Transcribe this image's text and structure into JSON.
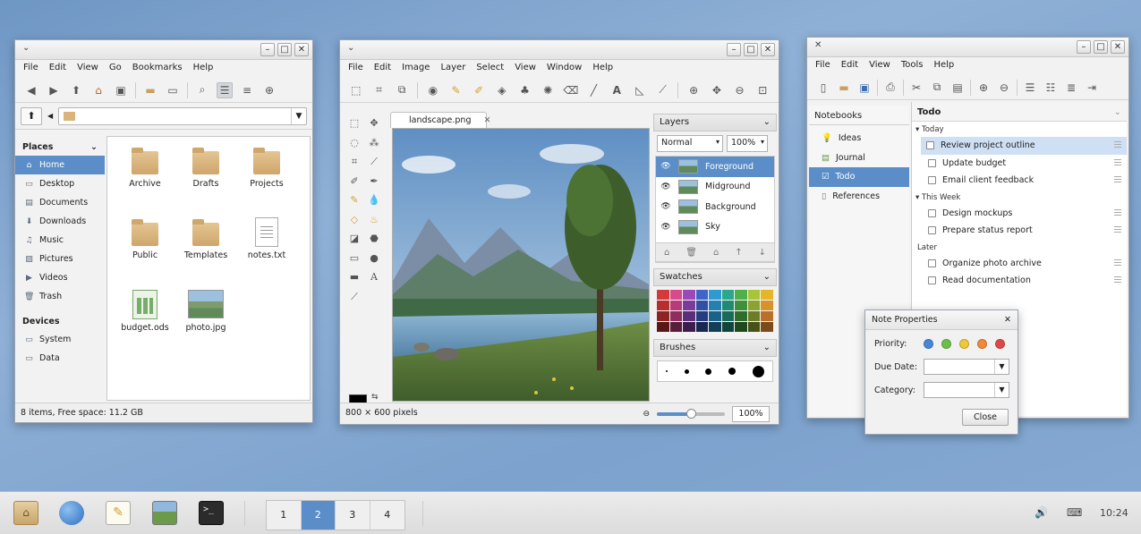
{
  "file_manager": {
    "menu": [
      "File",
      "Edit",
      "View",
      "Go",
      "Bookmarks",
      "Help"
    ],
    "places_header": "Places",
    "places": [
      {
        "label": "Home",
        "icon": "home-icon",
        "selected": true
      },
      {
        "label": "Desktop",
        "icon": "desktop-icon"
      },
      {
        "label": "Documents",
        "icon": "documents-icon"
      },
      {
        "label": "Downloads",
        "icon": "downloads-icon"
      },
      {
        "label": "Music",
        "icon": "music-icon"
      },
      {
        "label": "Pictures",
        "icon": "pictures-icon"
      },
      {
        "label": "Videos",
        "icon": "videos-icon"
      },
      {
        "label": "Trash",
        "icon": "trash-icon"
      }
    ],
    "devices_header": "Devices",
    "devices": [
      {
        "label": "System",
        "icon": "drive-icon"
      },
      {
        "label": "Data",
        "icon": "drive-icon"
      }
    ],
    "items": [
      {
        "label": "Archive",
        "type": "folder"
      },
      {
        "label": "Drafts",
        "type": "folder"
      },
      {
        "label": "Projects",
        "type": "folder"
      },
      {
        "label": "Public",
        "type": "folder"
      },
      {
        "label": "Templates",
        "type": "folder"
      },
      {
        "label": "notes.txt",
        "type": "text"
      },
      {
        "label": "budget.ods",
        "type": "spreadsheet"
      },
      {
        "label": "photo.jpg",
        "type": "image"
      }
    ],
    "status": "8 items, Free space: 11.2 GB"
  },
  "image_editor": {
    "menu": [
      "File",
      "Edit",
      "Image",
      "Layer",
      "Select",
      "View",
      "Window",
      "Help"
    ],
    "tab_label": "landscape.png",
    "layers_header": "Layers",
    "blend_mode": "Normal",
    "opacity": "100%",
    "layers": [
      {
        "label": "Foreground",
        "selected": true
      },
      {
        "label": "Midground"
      },
      {
        "label": "Background"
      },
      {
        "label": "Sky"
      }
    ],
    "swatches_header": "Swatches",
    "swatch_colors": [
      "#d23b3b",
      "#d84a8c",
      "#9b49b8",
      "#3e66c8",
      "#2f9ad2",
      "#2aa88e",
      "#4fb04a",
      "#a8c53a",
      "#e6b62a",
      "#b82d2d",
      "#b73a7a",
      "#7c3a9a",
      "#314fa6",
      "#2480b0",
      "#208a74",
      "#3f8f3b",
      "#8ba330",
      "#d8922a",
      "#8e2323",
      "#8e2d5e",
      "#5e2d78",
      "#253c80",
      "#1b6289",
      "#186a59",
      "#2f6d2d",
      "#6b7e25",
      "#b8702a",
      "#5a1717",
      "#5a1d3c",
      "#3c1d4d",
      "#182752",
      "#123f58",
      "#10453a",
      "#1f481e",
      "#465218",
      "#7d4a1c"
    ],
    "brushes_header": "Brushes",
    "status": "800 × 600 pixels",
    "zoom": "100%",
    "zoom_fraction": 0.5
  },
  "notes": {
    "menu": [
      "File",
      "Edit",
      "View",
      "Tools",
      "Help"
    ],
    "notebooks_header": "Notebooks",
    "notebooks": [
      {
        "label": "Ideas",
        "icon": "lightbulb-icon"
      },
      {
        "label": "Journal",
        "icon": "journal-icon"
      },
      {
        "label": "Todo",
        "icon": "checkbox-icon",
        "selected": true
      },
      {
        "label": "References",
        "icon": "document-icon"
      }
    ],
    "list_title": "Todo",
    "groups": [
      {
        "label": "Today",
        "tasks": [
          "Review project outline",
          "Update budget",
          "Email client feedback"
        ]
      },
      {
        "label": "This Week",
        "tasks": [
          "Design mockups",
          "Prepare status report"
        ]
      },
      {
        "label": "Later",
        "tasks": [
          "Organize photo archive",
          "Read documentation"
        ]
      }
    ]
  },
  "dialog": {
    "title": "Note Properties",
    "priority_label": "Priority:",
    "priority_colors": [
      "#4a86d8",
      "#6cc04a",
      "#f0c93a",
      "#f08a3a",
      "#e04848"
    ],
    "due_label": "Due Date:",
    "category_label": "Category:",
    "close_label": "Close"
  },
  "taskbar": {
    "workspaces": [
      "1",
      "2",
      "3",
      "4"
    ],
    "active_workspace": "2",
    "clock": "10:24"
  }
}
